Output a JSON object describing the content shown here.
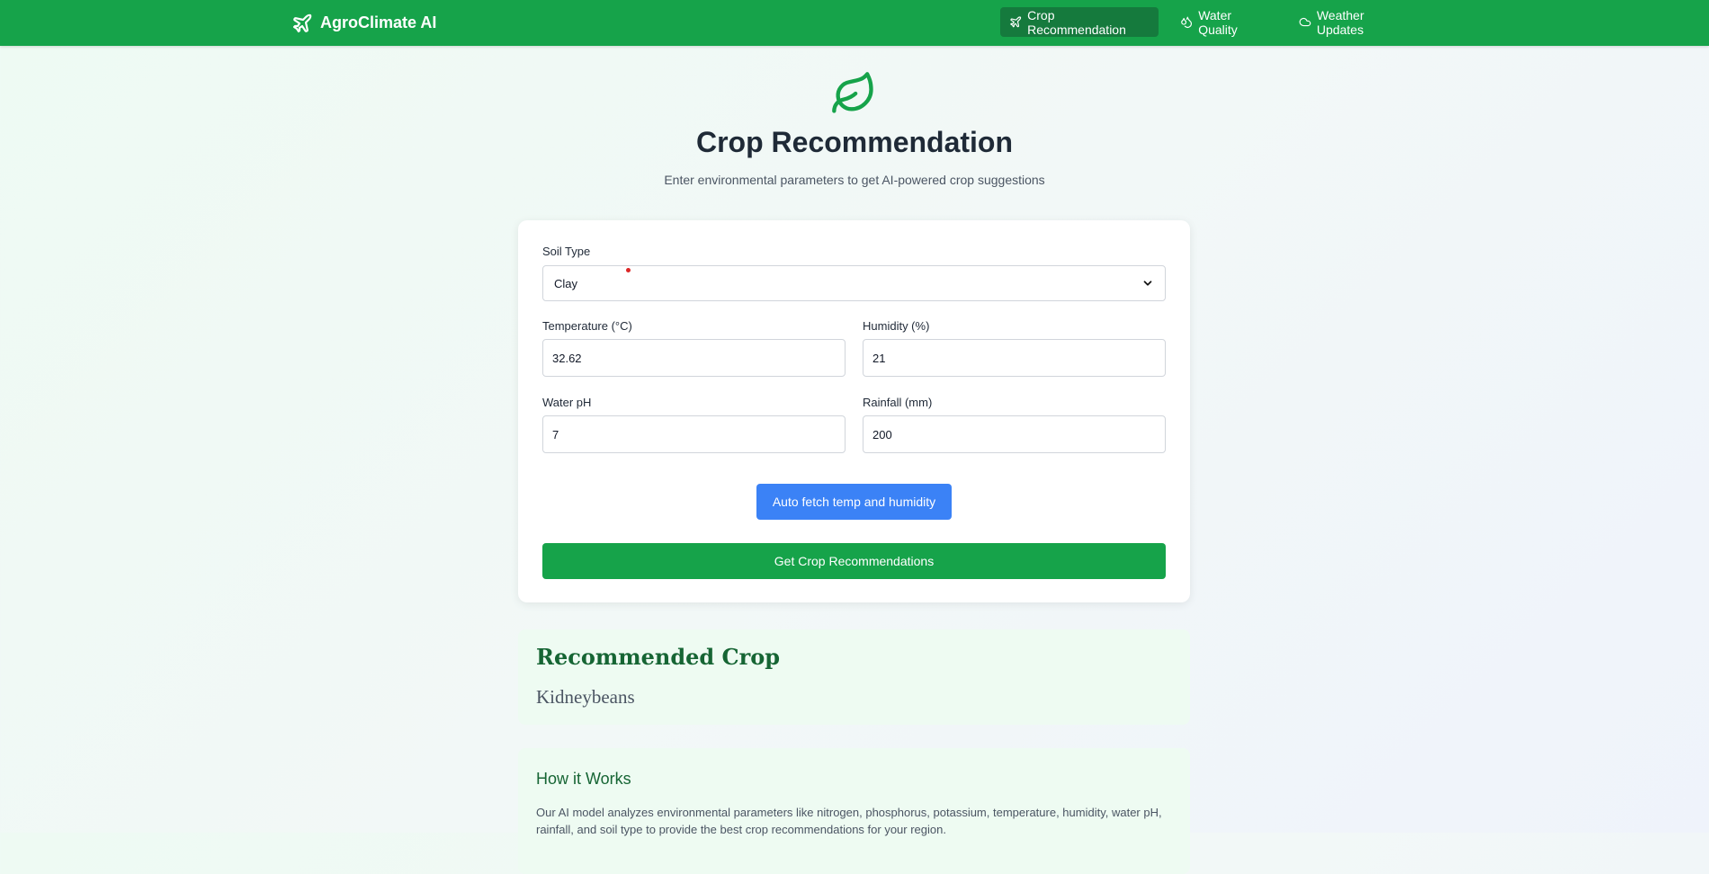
{
  "nav": {
    "brand": "AgroClimate AI",
    "brand_icon": "plane-icon",
    "items": [
      {
        "label": "Crop Recommendation",
        "icon": "plane-icon",
        "active": true
      },
      {
        "label": "Water Quality",
        "icon": "droplets-icon",
        "active": false
      },
      {
        "label": "Weather Updates",
        "icon": "cloud-icon",
        "active": false
      }
    ]
  },
  "hero": {
    "icon": "leaf-icon",
    "title": "Crop Recommendation",
    "subtitle": "Enter environmental parameters to get AI-powered crop suggestions"
  },
  "form": {
    "soil_type": {
      "label": "Soil Type",
      "value": "Clay"
    },
    "temperature": {
      "label": "Temperature (°C)",
      "value": "32.62"
    },
    "humidity": {
      "label": "Humidity (%)",
      "value": "21"
    },
    "water_ph": {
      "label": "Water pH",
      "value": "7"
    },
    "rainfall": {
      "label": "Rainfall (mm)",
      "value": "200"
    },
    "auto_fetch_label": "Auto fetch temp and humidity",
    "submit_label": "Get Crop Recommendations"
  },
  "result": {
    "title": "Recommended Crop",
    "crop": "Kidneybeans"
  },
  "how": {
    "title": "How it Works",
    "text": "Our AI model analyzes environmental parameters like nitrogen, phosphorus, potassium, temperature, humidity, water pH, rainfall, and soil type to provide the best crop recommendations for your region."
  },
  "colors": {
    "primary_green": "#16a34a",
    "active_nav": "#157a3d",
    "blue_button": "#3b82f6",
    "result_title": "#166534"
  }
}
